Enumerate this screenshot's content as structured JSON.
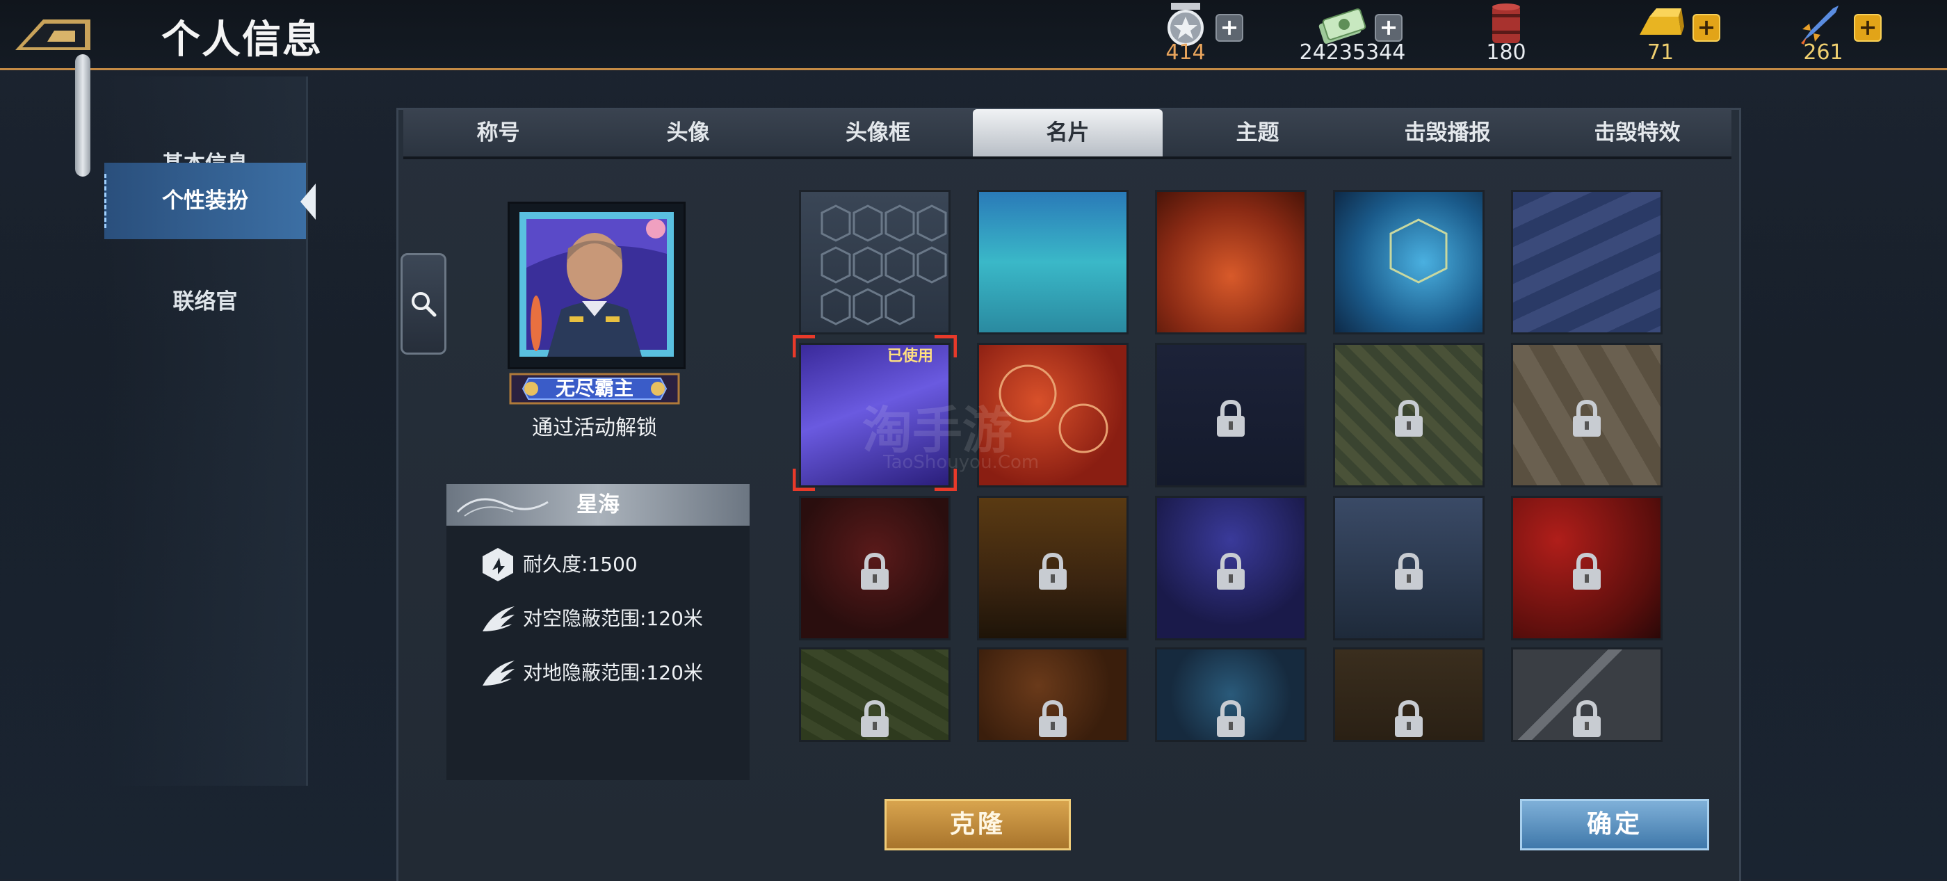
{
  "header": {
    "title": "个人信息"
  },
  "currencies": [
    {
      "icon": "medal-icon",
      "value": "414",
      "color": "#e8a45c",
      "plus": "+"
    },
    {
      "icon": "cash-icon",
      "value": "24235344",
      "color": "#e8ecf0",
      "plus": "+"
    },
    {
      "icon": "oil-barrel-icon",
      "value": "180",
      "color": "#e8ecf0"
    },
    {
      "icon": "gold-bar-icon",
      "value": "71",
      "color": "#f0d070",
      "plus": "+"
    },
    {
      "icon": "rocket-icon",
      "value": "261",
      "color": "#f0d070",
      "plus": "+"
    }
  ],
  "sidebar": {
    "items": [
      {
        "label": "基本信息",
        "active": false
      },
      {
        "label": "个性装扮",
        "active": true
      },
      {
        "label": "联络官",
        "active": false
      }
    ]
  },
  "tabs": [
    {
      "label": "称号",
      "active": false
    },
    {
      "label": "头像",
      "active": false
    },
    {
      "label": "头像框",
      "active": false
    },
    {
      "label": "名片",
      "active": true
    },
    {
      "label": "主题",
      "active": false
    },
    {
      "label": "击毁播报",
      "active": false
    },
    {
      "label": "击毁特效",
      "active": false
    }
  ],
  "preview": {
    "title_badge": "无尽霸主",
    "unlock_text": "通过活动解锁"
  },
  "card_info": {
    "name": "星海",
    "stats": [
      {
        "icon": "shield-durability-icon",
        "text": "耐久度:1500"
      },
      {
        "icon": "wing-stealth-icon",
        "text": "对空隐蔽范围:120米"
      },
      {
        "icon": "wing-stealth-icon",
        "text": "对地隐蔽范围:120米"
      }
    ]
  },
  "grid": {
    "used_label": "已使用",
    "cards": [
      {
        "name": "hexagon-pattern",
        "locked": false
      },
      {
        "name": "ocean",
        "locked": false
      },
      {
        "name": "flames",
        "locked": false
      },
      {
        "name": "tech-hexagon",
        "locked": false
      },
      {
        "name": "blue-stripes",
        "locked": false
      },
      {
        "name": "star-sea",
        "locked": false,
        "selected": true
      },
      {
        "name": "red-flowers",
        "locked": false
      },
      {
        "name": "dark-star",
        "locked": true
      },
      {
        "name": "digital-camo",
        "locked": true
      },
      {
        "name": "desert-diamond",
        "locked": true
      },
      {
        "name": "red-dark",
        "locked": true
      },
      {
        "name": "sunset",
        "locked": true
      },
      {
        "name": "night-sky",
        "locked": true
      },
      {
        "name": "helicopter-battle",
        "locked": true
      },
      {
        "name": "red-star-flag",
        "locked": true
      },
      {
        "name": "floral-gold",
        "locked": true
      },
      {
        "name": "autumn-leaves",
        "locked": true
      },
      {
        "name": "snowflake",
        "locked": true
      },
      {
        "name": "star-brown",
        "locked": true
      },
      {
        "name": "steel-stripe",
        "locked": true
      }
    ]
  },
  "buttons": {
    "clone": "克隆",
    "confirm": "确定"
  },
  "watermark": {
    "main": "淘手游",
    "sub": "TaoShouyou.Com"
  }
}
